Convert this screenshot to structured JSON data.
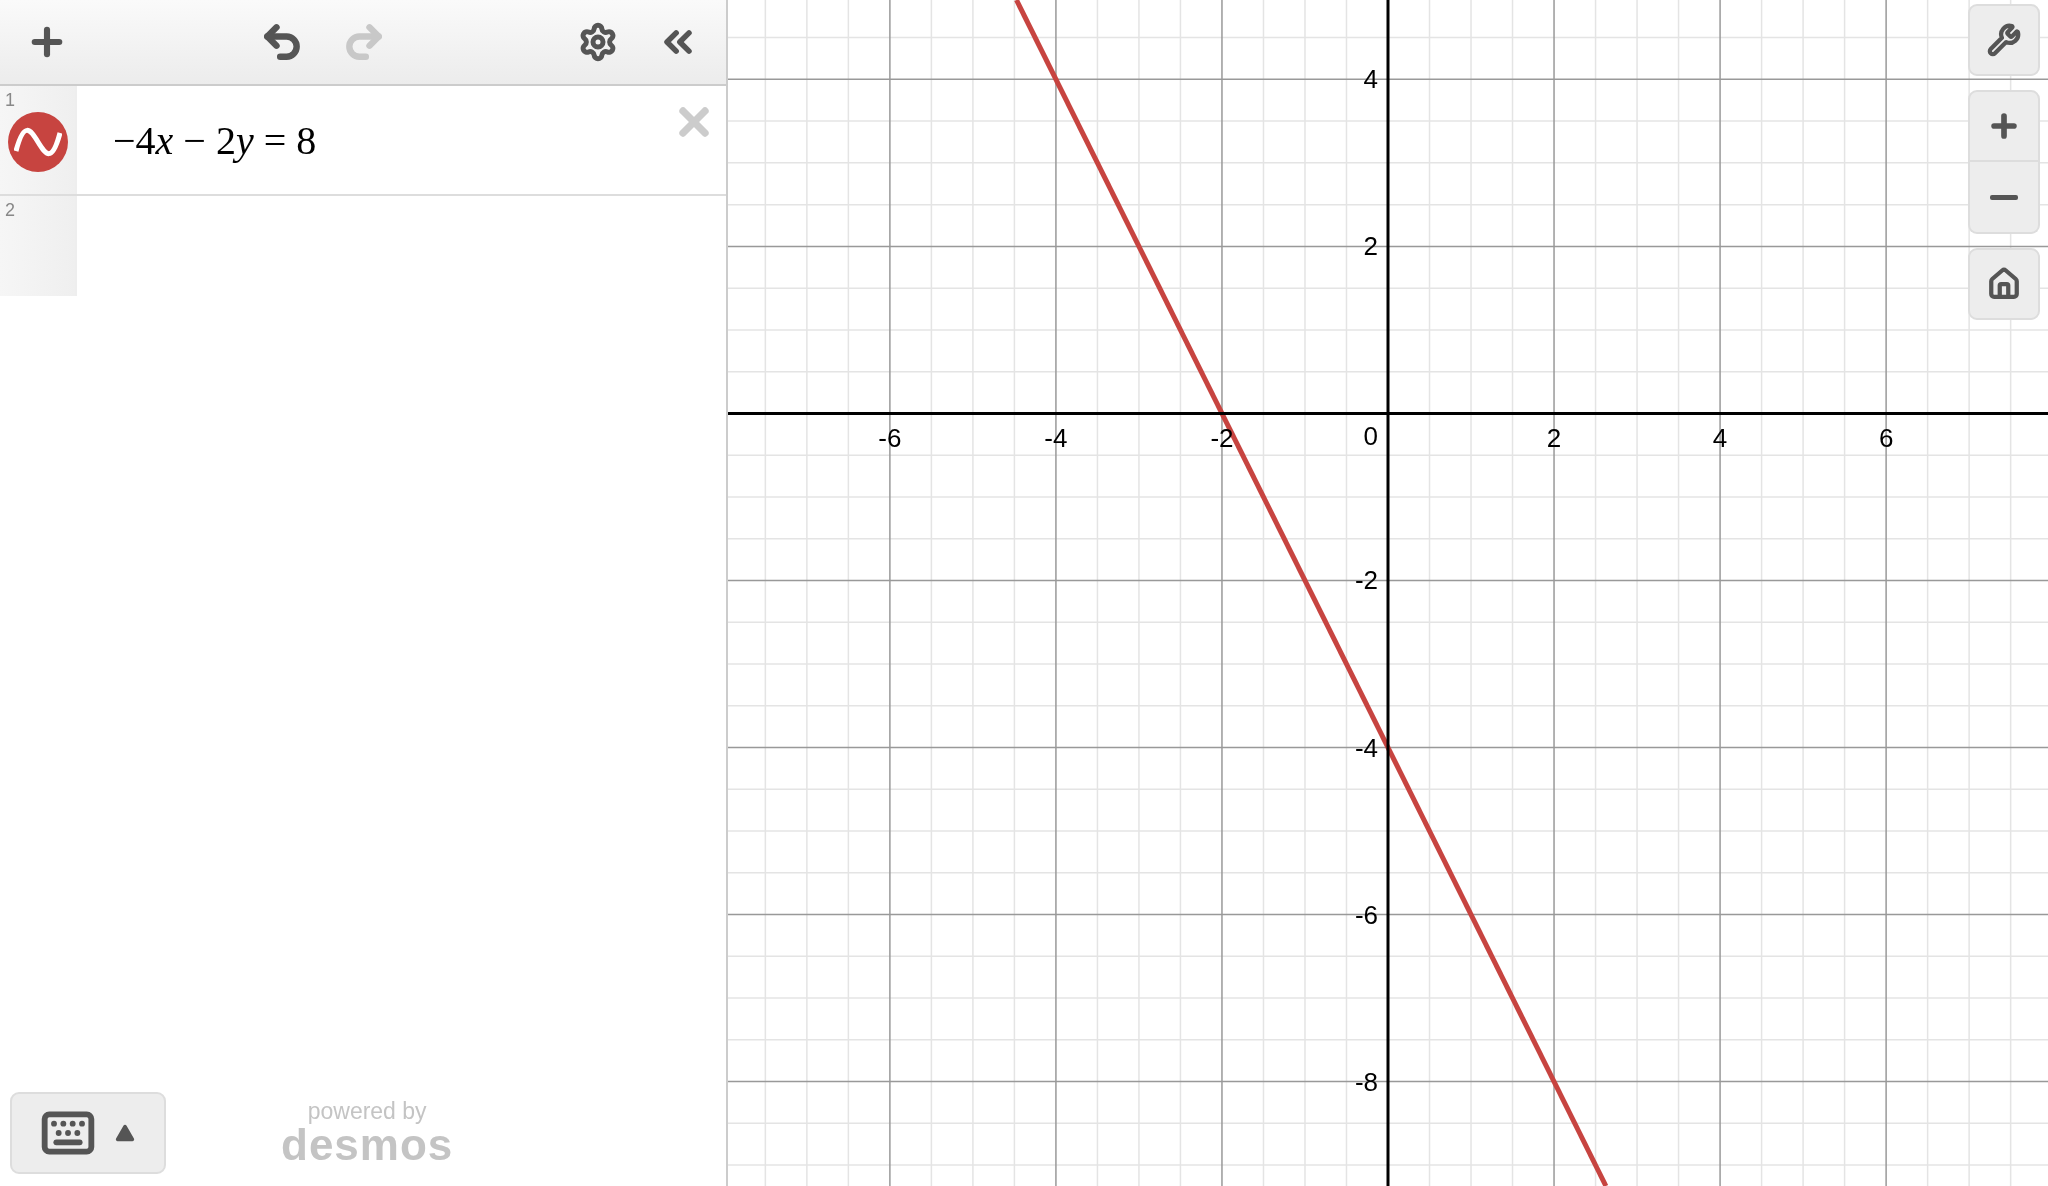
{
  "toolbar": {
    "undo": {
      "disabled": false
    },
    "redo": {
      "disabled": true
    }
  },
  "expressions": [
    {
      "number": "1",
      "parts": [
        {
          "text": "−4"
        },
        {
          "text": "x",
          "italic": true
        },
        {
          "text": " − 2"
        },
        {
          "text": "y",
          "italic": true
        },
        {
          "text": " = 8"
        }
      ],
      "color": "#c74440"
    },
    {
      "number": "2"
    }
  ],
  "footer": {
    "powered_by": "powered by",
    "brand": "desmos"
  },
  "graph": {
    "origin_label": "0",
    "chart_data": {
      "type": "line",
      "grid": true,
      "xlim": [
        -7.95,
        7.95
      ],
      "ylim": [
        -9.25,
        4.95
      ],
      "xticks": [
        -6,
        -4,
        -2,
        2,
        4,
        6
      ],
      "yticks": [
        -8,
        -6,
        -4,
        -2,
        2,
        4
      ],
      "x": [
        -4.475,
        2.625
      ],
      "series": [
        {
          "color": "#c74440",
          "values": [
            4.95,
            -9.25
          ]
        }
      ]
    }
  }
}
